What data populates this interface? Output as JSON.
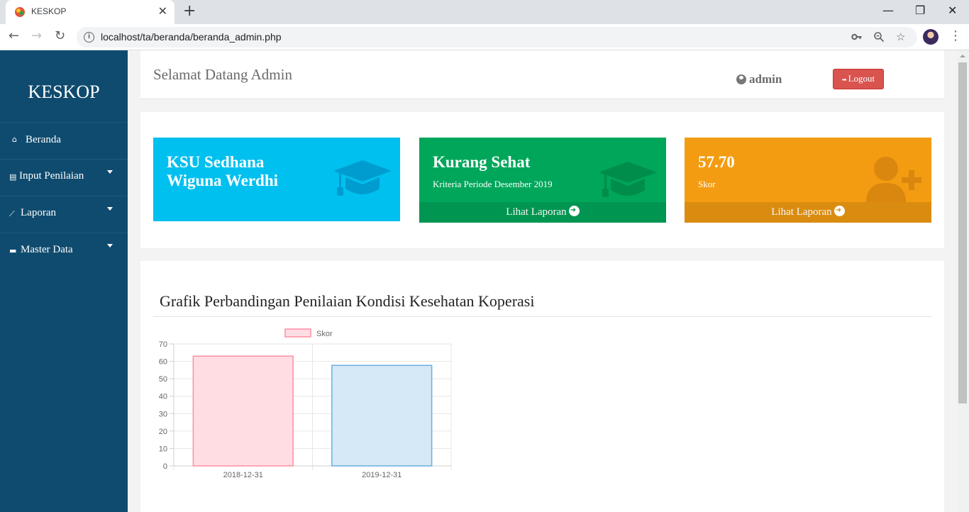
{
  "browser": {
    "tab_title": "KESKOP",
    "tab_close": "✕",
    "new_tab": "+",
    "url": "localhost/ta/beranda/beranda_admin.php",
    "window_controls": {
      "minimize": "—",
      "restore": "❐",
      "close": "✕"
    },
    "icons": [
      "back-arrow-icon",
      "forward-arrow-icon",
      "reload-icon",
      "info-icon",
      "key-icon",
      "zoom-icon",
      "star-icon",
      "profile-avatar",
      "menu-dots-icon"
    ]
  },
  "sidebar": {
    "brand": "KESKOP",
    "items": [
      {
        "label": "Beranda",
        "icon": "home-icon",
        "glyph": "⌂",
        "dropdown": false
      },
      {
        "label": "Input Penilaian",
        "icon": "file-icon",
        "glyph": "▤",
        "dropdown": true
      },
      {
        "label": "Laporan",
        "icon": "line-chart-icon",
        "glyph": "⟋",
        "dropdown": true
      },
      {
        "label": "Master Data",
        "icon": "folder-icon",
        "glyph": "▬",
        "dropdown": true
      }
    ]
  },
  "header": {
    "welcome": "Selamat Datang Admin",
    "user": "admin",
    "logout_label": "Logout"
  },
  "stats": [
    {
      "title": "KSU Sedhana Wiguna Werdhi",
      "title_line1": "KSU Sedhana",
      "title_line2": "Wiguna Werdhi",
      "subtitle": "",
      "icon": "graduation-cap-icon",
      "color": "#00c0ef"
    },
    {
      "title": "Kurang Sehat",
      "subtitle": "Kriteria Periode Desember 2019",
      "link": "Lihat Laporan",
      "icon": "graduation-cap-icon",
      "color": "#00a65a"
    },
    {
      "title": "57.70",
      "subtitle": "Skor",
      "link": "Lihat Laporan",
      "icon": "user-plus-icon",
      "color": "#f39c12"
    }
  ],
  "chart_title": "Grafik Perbandingan Penilaian Kondisi Kesehatan Koperasi",
  "chart_data": {
    "type": "bar",
    "categories": [
      "2018-12-31",
      "2019-12-31"
    ],
    "series": [
      {
        "name": "Skor",
        "values": [
          63,
          57.7
        ]
      }
    ],
    "bar_colors": [
      "#ffdde3",
      "#d5e9f7"
    ],
    "bar_borders": [
      "#ff8fa3",
      "#6ab0de"
    ],
    "ylim": [
      0,
      70
    ],
    "yticks": [
      0,
      10,
      20,
      30,
      40,
      50,
      60,
      70
    ],
    "legend": "top",
    "grid": true
  }
}
